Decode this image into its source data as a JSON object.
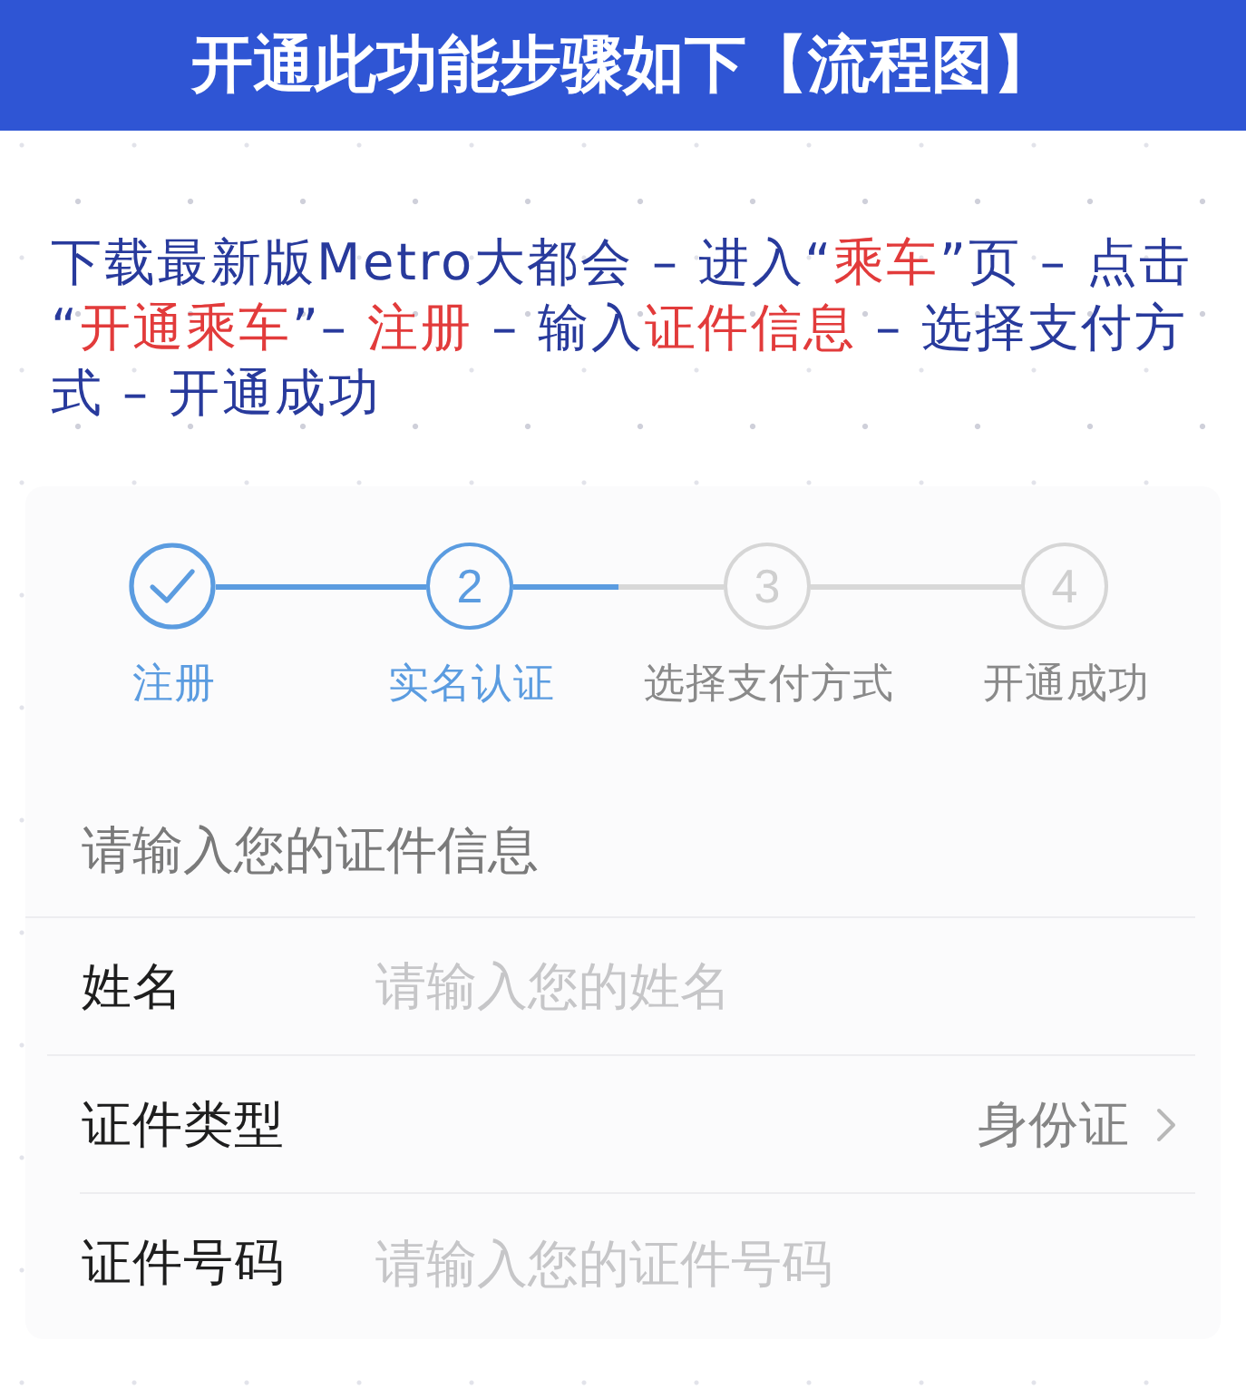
{
  "header": {
    "title": "开通此功能步骤如下【流程图】"
  },
  "intro": {
    "lines": [
      [
        {
          "text": "下载最新版Metro大都会 – 进入“",
          "kind": "plain"
        },
        {
          "text": "乘车",
          "kind": "highlight"
        },
        {
          "text": "”页 – 点击",
          "kind": "plain"
        }
      ],
      [
        {
          "text": "“",
          "kind": "plain"
        },
        {
          "text": "开通乘车",
          "kind": "highlight"
        },
        {
          "text": "”– ",
          "kind": "plain"
        },
        {
          "text": "注册",
          "kind": "highlight"
        },
        {
          "text": " – 输入",
          "kind": "plain"
        },
        {
          "text": "证件信息",
          "kind": "highlight"
        },
        {
          "text": " – 选择支付方",
          "kind": "plain"
        }
      ],
      [
        {
          "text": "式 – 开通成功",
          "kind": "plain"
        }
      ]
    ]
  },
  "stepper": {
    "steps": [
      {
        "label": "注册",
        "done": true,
        "current": false
      },
      {
        "number": "2",
        "label": "实名认证",
        "done": false,
        "current": true
      },
      {
        "number": "3",
        "label": "选择支付方式",
        "done": false,
        "current": false
      },
      {
        "number": "4",
        "label": "开通成功",
        "done": false,
        "current": false
      }
    ]
  },
  "form": {
    "heading": "请输入您的证件信息",
    "fields": [
      {
        "kind": "input",
        "label": "姓名",
        "placeholder": "请输入您的姓名"
      },
      {
        "kind": "select",
        "label": "证件类型",
        "value": "身份证"
      },
      {
        "kind": "input",
        "label": "证件号码",
        "placeholder": "请输入您的证件号码"
      }
    ]
  }
}
